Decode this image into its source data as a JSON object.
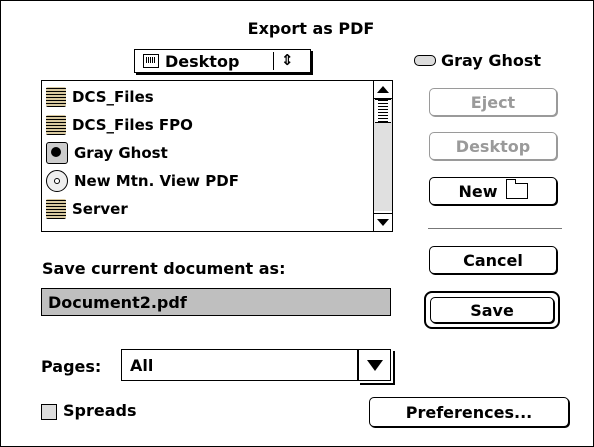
{
  "dialog": {
    "title": "Export as PDF"
  },
  "location_popup": {
    "selected": "Desktop",
    "icon": "desktop-icon"
  },
  "drive": {
    "name": "Gray Ghost",
    "icon": "drive-icon"
  },
  "file_list": {
    "items": [
      {
        "label": "DCS_Files",
        "icon": "server-icon"
      },
      {
        "label": "DCS_Files FPO",
        "icon": "server-icon"
      },
      {
        "label": "Gray Ghost",
        "icon": "hard-drive-icon"
      },
      {
        "label": "New Mtn. View PDF",
        "icon": "cd-icon"
      },
      {
        "label": "Server",
        "icon": "server-icon"
      }
    ]
  },
  "buttons": {
    "eject": "Eject",
    "desktop": "Desktop",
    "new": "New",
    "cancel": "Cancel",
    "save": "Save",
    "preferences": "Preferences..."
  },
  "save_as": {
    "label": "Save current document as:",
    "value": "Document2.pdf"
  },
  "pages": {
    "label": "Pages:",
    "value": "All"
  },
  "spreads": {
    "label": "Spreads",
    "checked": false
  }
}
